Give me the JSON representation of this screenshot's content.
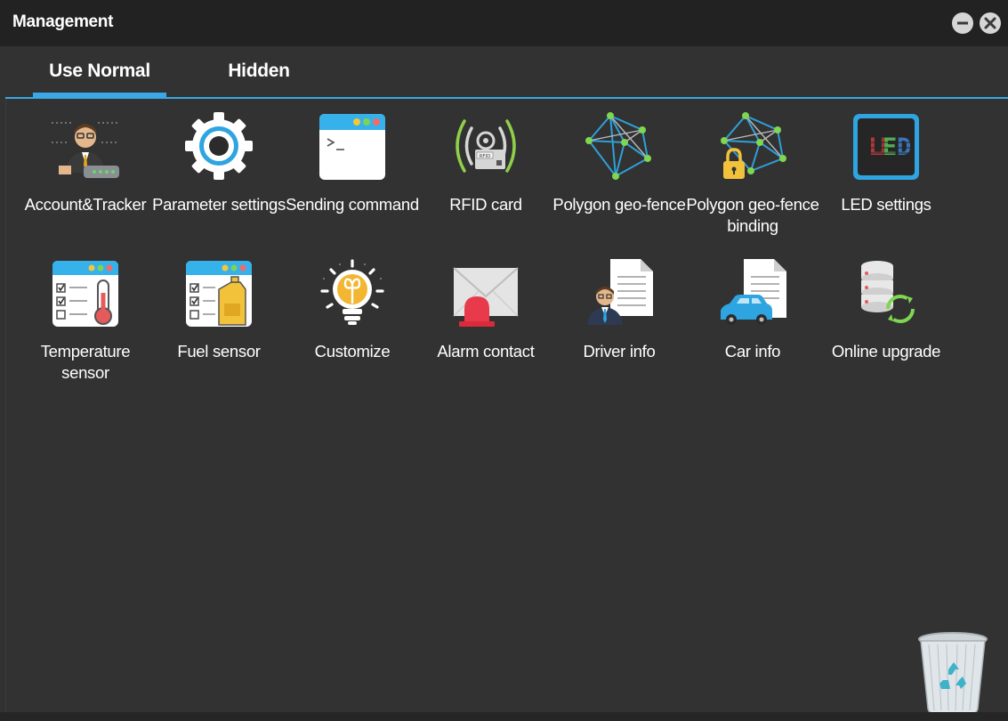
{
  "window": {
    "title": "Management"
  },
  "tabs": [
    {
      "label": "Use Normal",
      "active": true
    },
    {
      "label": "Hidden",
      "active": false
    }
  ],
  "items": [
    {
      "label": "Account&Tracker",
      "icon": "account-tracker-icon"
    },
    {
      "label": "Parameter settings",
      "icon": "gear-icon"
    },
    {
      "label": "Sending command",
      "icon": "terminal-icon"
    },
    {
      "label": "RFID card",
      "icon": "rfid-icon"
    },
    {
      "label": "Polygon geo-fence",
      "icon": "polygon-network-icon"
    },
    {
      "label": "Polygon geo-fence binding",
      "icon": "polygon-lock-icon"
    },
    {
      "label": "LED settings",
      "icon": "led-icon"
    },
    {
      "label": "Temperature sensor",
      "icon": "thermometer-icon"
    },
    {
      "label": "Fuel sensor",
      "icon": "fuel-can-icon"
    },
    {
      "label": "Customize",
      "icon": "lightbulb-icon"
    },
    {
      "label": "Alarm contact",
      "icon": "alarm-mail-icon"
    },
    {
      "label": "Driver info",
      "icon": "driver-document-icon"
    },
    {
      "label": "Car info",
      "icon": "car-document-icon"
    },
    {
      "label": "Online upgrade",
      "icon": "database-refresh-icon"
    }
  ],
  "colors": {
    "accent": "#3aa8e6",
    "titlebar": "#222222",
    "background": "#323232"
  },
  "icons": {
    "minimize": "minimize-icon",
    "close": "close-icon",
    "recycle_bin": "recycle-bin-icon"
  }
}
